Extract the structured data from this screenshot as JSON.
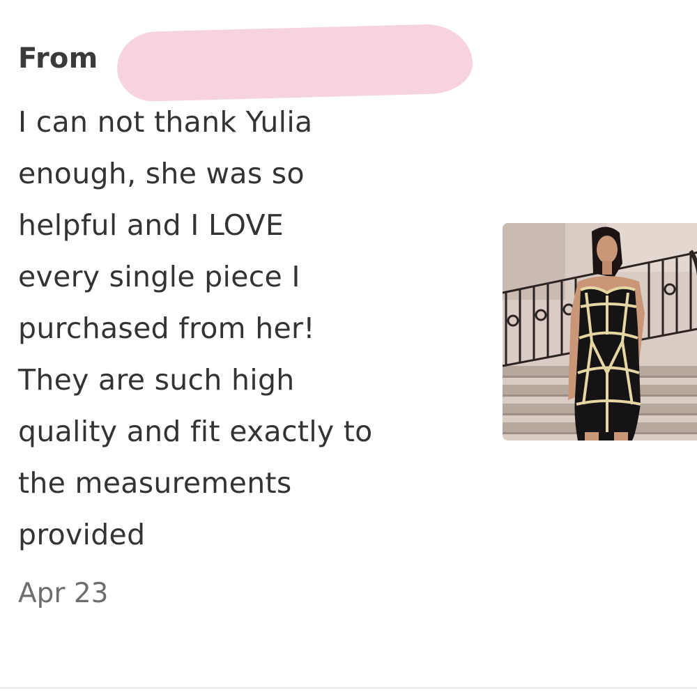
{
  "message": {
    "from_label": "From",
    "sender_redacted": true,
    "body": "I can not thank Yulia\nenough, she was so\nhelpful and I LOVE\nevery single piece I\npurchased from her!\nThey are such high\nquality and fit exactly to\nthe measurements\nprovided",
    "date": "Apr 23"
  },
  "attachment": {
    "type": "image",
    "icon": "product-photo-black-bandage-dress"
  },
  "colors": {
    "redaction": "#f6d3de",
    "text": "#333333",
    "date": "#6d6d6d"
  }
}
